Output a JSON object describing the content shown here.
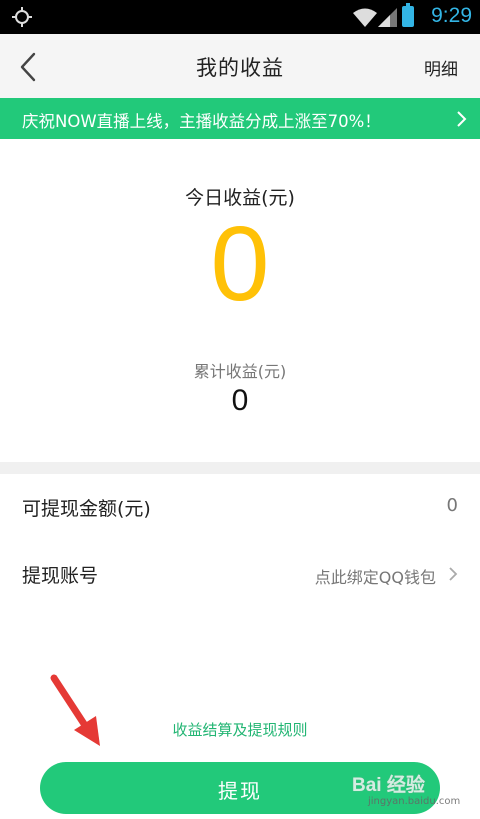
{
  "status_bar": {
    "time": "9:29",
    "icons": [
      "target-icon",
      "wifi-icon",
      "signal-icon",
      "battery-icon"
    ],
    "text_color": "#33b5e5"
  },
  "header": {
    "back_icon": "chevron-left-icon",
    "title": "我的收益",
    "detail_label": "明细"
  },
  "banner": {
    "text": "庆祝NOW直播上线，主播收益分成上涨至70%！",
    "chevron_icon": "chevron-right-icon",
    "color": "#22c97a"
  },
  "earnings": {
    "today_label": "今日收益(元)",
    "today_value": "0",
    "today_color": "#ffc107",
    "total_label": "累计收益(元)",
    "total_value": "0"
  },
  "rows": {
    "withdrawable": {
      "label": "可提现金额(元)",
      "value": "0"
    },
    "account": {
      "label": "提现账号",
      "value": "点此绑定QQ钱包",
      "chevron_icon": "chevron-right-icon"
    }
  },
  "footer": {
    "rules_link": "收益结算及提现规则",
    "withdraw_button": "提现",
    "accent_color": "#22c97a"
  },
  "overlay": {
    "arrow_icon": "red-arrow-icon",
    "watermark_main": "Bai 经验",
    "watermark_sub": "jingyan.baidu.com"
  }
}
